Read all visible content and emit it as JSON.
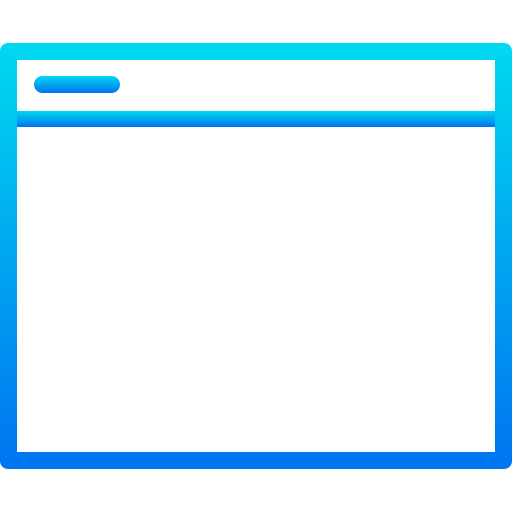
{
  "icon": {
    "name": "browser-window-icon",
    "gradient": {
      "top_color": "#00d9f0",
      "bottom_color": "#0074f0"
    }
  }
}
